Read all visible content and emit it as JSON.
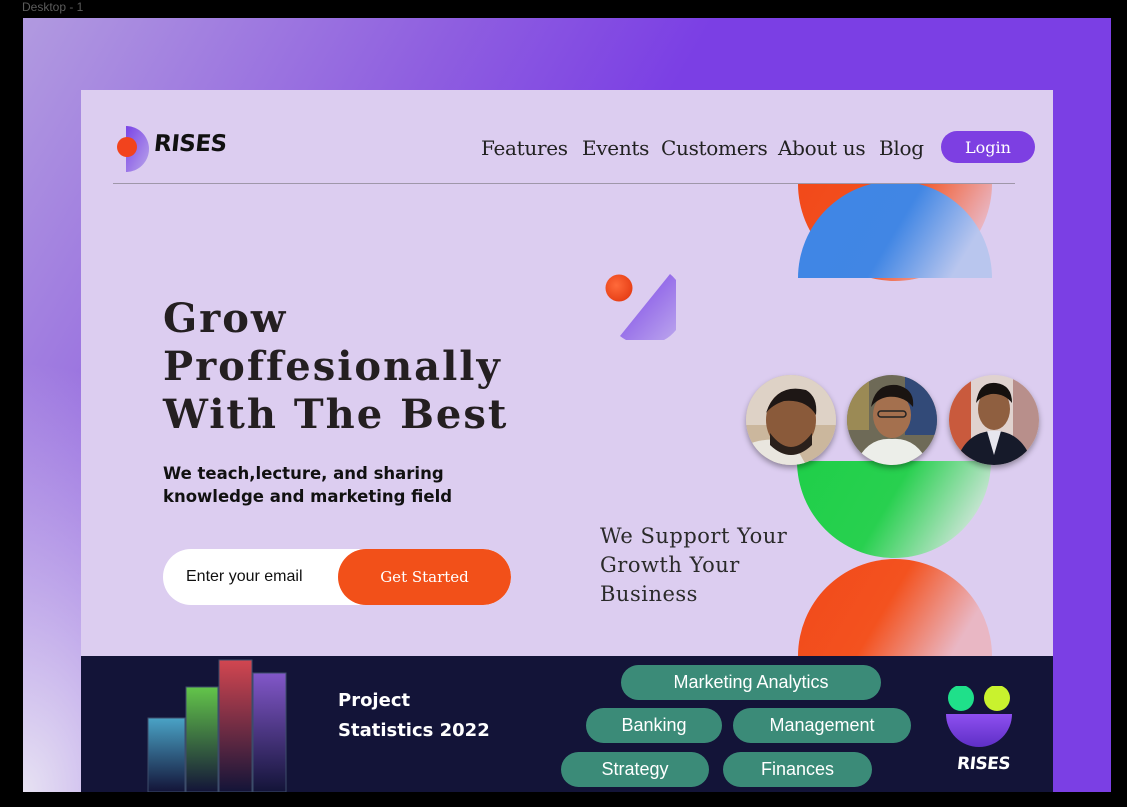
{
  "frame": {
    "label": "Desktop - 1"
  },
  "header": {
    "logo_text": "RISES",
    "nav": [
      {
        "label": "Features"
      },
      {
        "label": "Events"
      },
      {
        "label": "Customers"
      },
      {
        "label": "About us"
      },
      {
        "label": "Blog"
      }
    ],
    "login_label": "Login"
  },
  "hero": {
    "headline": [
      "Grow",
      "Proffesionally",
      "With The Best"
    ],
    "subtitle": "We teach,lecture, and sharing knowledge and marketing field",
    "email_placeholder": "Enter your email",
    "cta_label": "Get Started",
    "tagline": [
      "We Support Your",
      "Growth Your",
      "Business"
    ]
  },
  "stats": {
    "title": [
      "Project",
      "Statistics 2022"
    ],
    "tags": [
      {
        "label": "Marketing Analytics"
      },
      {
        "label": "Banking"
      },
      {
        "label": "Management"
      },
      {
        "label": "Strategy"
      },
      {
        "label": "Finances"
      }
    ],
    "logo_text": "RISES"
  },
  "colors": {
    "primary": "#7d3fe2",
    "accent_orange": "#f25019",
    "blue": "#3f8ae6",
    "green": "#22cf4c",
    "card_bg": "#dccdf0",
    "footer_bg": "#131438",
    "pill_bg": "#3b8b78"
  }
}
